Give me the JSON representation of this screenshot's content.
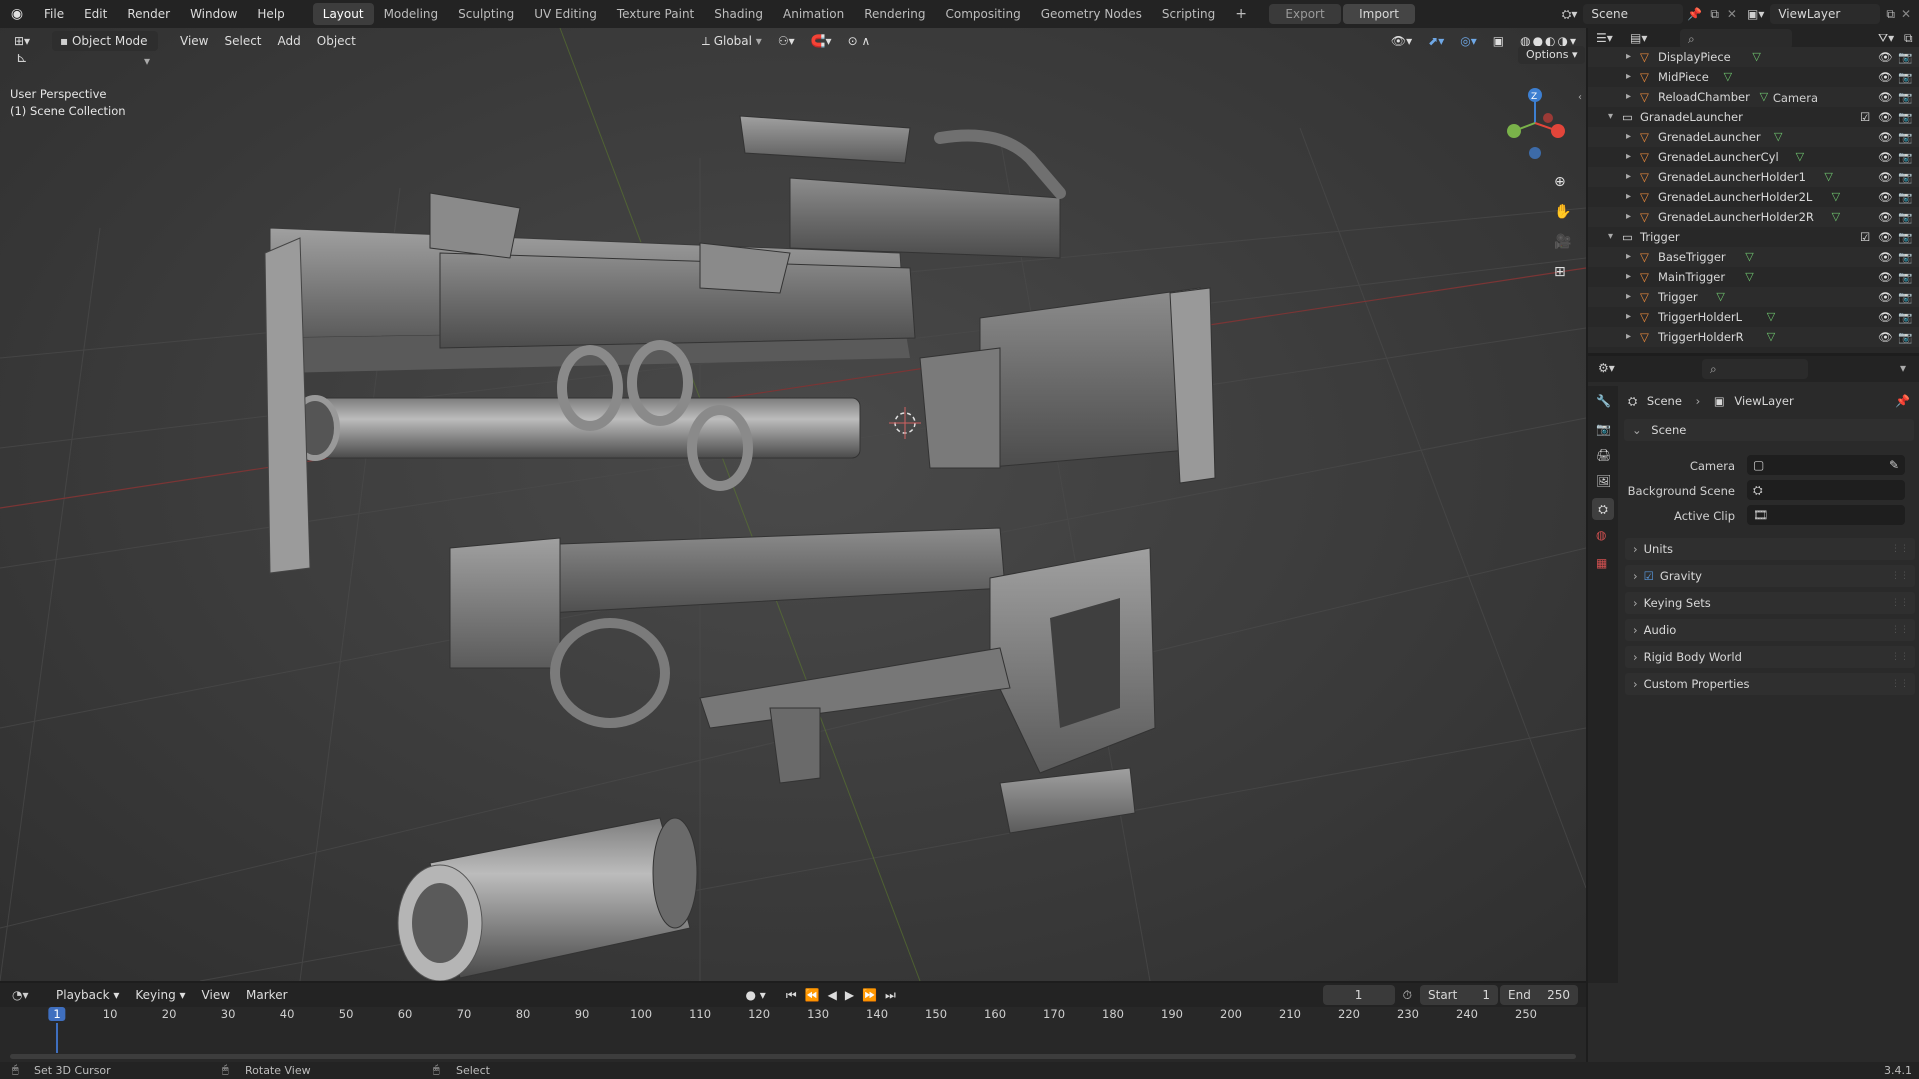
{
  "topbar": {
    "menus": [
      "File",
      "Edit",
      "Render",
      "Window",
      "Help"
    ],
    "workspaces": [
      "Layout",
      "Modeling",
      "Sculpting",
      "UV Editing",
      "Texture Paint",
      "Shading",
      "Animation",
      "Rendering",
      "Compositing",
      "Geometry Nodes",
      "Scripting"
    ],
    "active_workspace": "Layout",
    "add_tab": "+",
    "export_label": "Export",
    "import_label": "Import",
    "scene_name": "Scene",
    "view_layer": "ViewLayer"
  },
  "viewport": {
    "mode": "Object Mode",
    "menus": [
      "View",
      "Select",
      "Add",
      "Object"
    ],
    "transform_orientation": "Global",
    "options_label": "Options",
    "perspective_label": "User Perspective",
    "collection_label": "(1) Scene Collection",
    "gizmo": {
      "z": "Z",
      "x_color": "#e2453a",
      "y_color": "#7ab24a",
      "z_color": "#3d7fd1"
    }
  },
  "outliner": {
    "rows": [
      {
        "indent": 2,
        "label": "DisplayPiece",
        "type": "mesh",
        "expand": "▸"
      },
      {
        "indent": 2,
        "label": "MidPiece",
        "type": "mesh",
        "expand": "▸"
      },
      {
        "indent": 2,
        "label": "ReloadChamber",
        "type": "mesh",
        "expand": "▸"
      },
      {
        "indent": 1,
        "label": "GranadeLauncher",
        "type": "collection",
        "expand": "▾"
      },
      {
        "indent": 2,
        "label": "GrenadeLauncher",
        "type": "mesh",
        "expand": "▸"
      },
      {
        "indent": 2,
        "label": "GrenadeLauncherCyl",
        "type": "mesh",
        "expand": "▸"
      },
      {
        "indent": 2,
        "label": "GrenadeLauncherHolder1",
        "type": "mesh",
        "expand": "▸"
      },
      {
        "indent": 2,
        "label": "GrenadeLauncherHolder2L",
        "type": "mesh",
        "expand": "▸"
      },
      {
        "indent": 2,
        "label": "GrenadeLauncherHolder2R",
        "type": "mesh",
        "expand": "▸"
      },
      {
        "indent": 1,
        "label": "Trigger",
        "type": "collection",
        "expand": "▾"
      },
      {
        "indent": 2,
        "label": "BaseTrigger",
        "type": "mesh",
        "expand": "▸"
      },
      {
        "indent": 2,
        "label": "MainTrigger",
        "type": "mesh",
        "expand": "▸"
      },
      {
        "indent": 2,
        "label": "Trigger",
        "type": "mesh",
        "expand": "▸"
      },
      {
        "indent": 2,
        "label": "TriggerHolderL",
        "type": "mesh",
        "expand": "▸"
      },
      {
        "indent": 2,
        "label": "TriggerHolderR",
        "type": "mesh",
        "expand": "▸"
      }
    ]
  },
  "properties": {
    "breadcrumb_scene": "Scene",
    "breadcrumb_layer": "ViewLayer",
    "scene_panel": "Scene",
    "camera_label": "Camera",
    "background_scene_label": "Background Scene",
    "active_clip_label": "Active Clip",
    "panels": [
      "Units",
      "Gravity",
      "Keying Sets",
      "Audio",
      "Rigid Body World",
      "Custom Properties"
    ],
    "gravity_checked": true
  },
  "timeline": {
    "menus": [
      "Playback",
      "Keying",
      "View",
      "Marker"
    ],
    "current_frame": "1",
    "start_label": "Start",
    "start_value": "1",
    "end_label": "End",
    "end_value": "250",
    "ticks": [
      "1",
      "10",
      "20",
      "30",
      "40",
      "50",
      "60",
      "70",
      "80",
      "90",
      "100",
      "110",
      "120",
      "130",
      "140",
      "150",
      "160",
      "170",
      "180",
      "190",
      "200",
      "210",
      "220",
      "230",
      "240",
      "250"
    ]
  },
  "statusbar": {
    "hint1": "Set 3D Cursor",
    "hint2": "Rotate View",
    "hint3": "Select",
    "version": "3.4.1"
  }
}
